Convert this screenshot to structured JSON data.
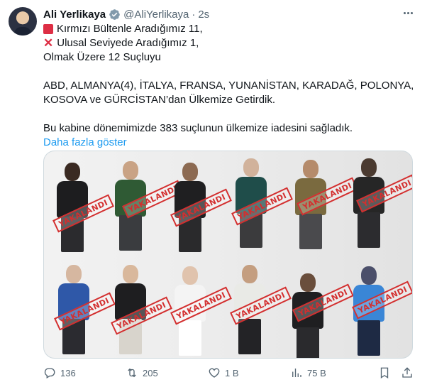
{
  "author": {
    "name": "Ali Yerlikaya",
    "handle": "@AliYerlikaya",
    "separator": "·",
    "time": "2s"
  },
  "tweet": {
    "line1": "Kırmızı Bültenle Aradığımız 11,",
    "line2": "Ulusal Seviyede Aradığımız 1,",
    "line3": "Olmak Üzere 12 Suçluyu",
    "line4": "ABD, ALMANYA(4), İTALYA, FRANSA, YUNANİSTAN, KARADAĞ, POLONYA,",
    "line5": "KOSOVA ve GÜRCİSTAN’dan Ülkemize Getirdik.",
    "line6": "Bu kabine dönemimizde 383 suçlunun ülkemize iadesini sağladık.",
    "show_more": "Daha fazla göster"
  },
  "media": {
    "stamp_text": "YAKALANDI",
    "people_count": 12
  },
  "actions": {
    "replies": "136",
    "reposts": "205",
    "likes": "1 B",
    "views": "75 B"
  },
  "icons": {
    "verified": "verified-badge-icon",
    "more": "more-icon",
    "reply": "reply-icon",
    "repost": "repost-icon",
    "like": "heart-icon",
    "views": "views-icon",
    "bookmark": "bookmark-icon",
    "share": "share-icon"
  },
  "colors": {
    "accent": "#1d9bf0",
    "stamp": "#d32f2f",
    "muted": "#536471"
  }
}
